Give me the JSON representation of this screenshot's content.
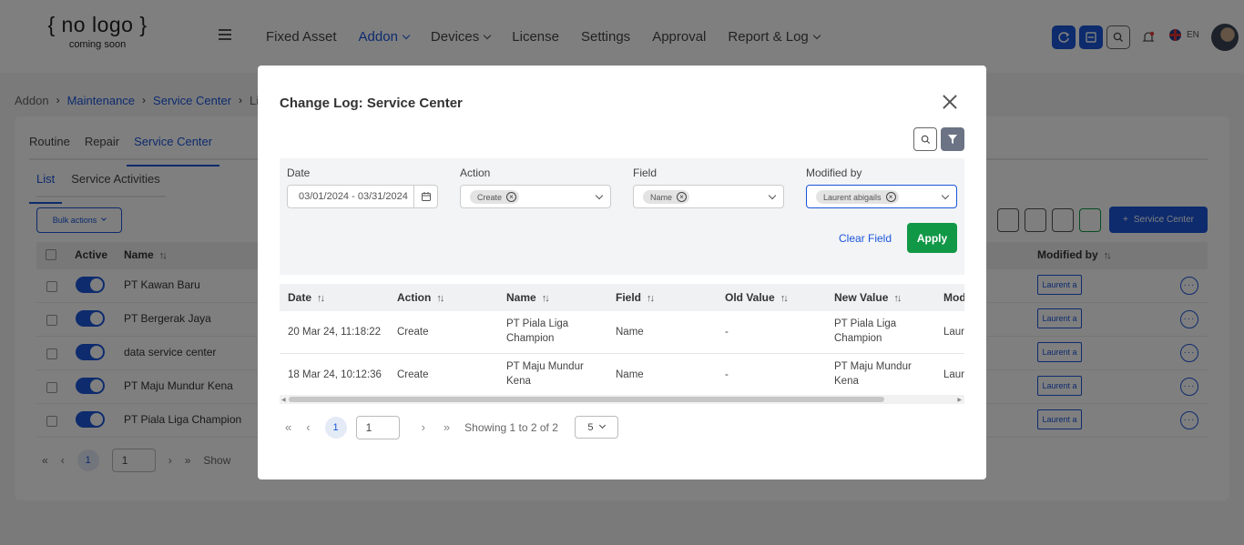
{
  "header": {
    "logo_main": "{ no logo }",
    "logo_sub": "coming soon",
    "nav": [
      {
        "label": "Fixed Asset"
      },
      {
        "label": "Addon"
      },
      {
        "label": "Devices"
      },
      {
        "label": "License"
      },
      {
        "label": "Settings"
      },
      {
        "label": "Approval"
      },
      {
        "label": "Report & Log"
      }
    ],
    "language": "EN",
    "accent_color": "#1a56db"
  },
  "breadcrumb": [
    "Addon",
    "Maintenance",
    "Service Center",
    "List"
  ],
  "page": {
    "tabs": [
      "Routine",
      "Repair",
      "Service Center"
    ],
    "subtabs": [
      "List",
      "Service Activities"
    ],
    "bulk_actions": "Bulk actions",
    "add_button": "Service Center",
    "columns": {
      "active": "Active",
      "name": "Name",
      "modified_by": "Modified by"
    },
    "rows": [
      {
        "name": "PT Kawan Baru",
        "modified_by": "Laurent a"
      },
      {
        "name": "PT Bergerak Jaya",
        "modified_by": "Laurent a"
      },
      {
        "name": "data service center",
        "modified_by": "Laurent a"
      },
      {
        "name": "PT Maju Mundur Kena",
        "modified_by": "Laurent a"
      },
      {
        "name": "PT Piala Liga Champion",
        "modified_by": "Laurent a"
      }
    ],
    "pagination": {
      "current_page": "1",
      "page_input": "1",
      "showing": "Show"
    }
  },
  "modal": {
    "title": "Change Log: Service Center",
    "filters": {
      "date_label": "Date",
      "date_value": "03/01/2024 - 03/31/2024",
      "action_label": "Action",
      "action_chip": "Create",
      "field_label": "Field",
      "field_chip": "Name",
      "modified_label": "Modified by",
      "modified_chip": "Laurent abigails",
      "clear": "Clear Field",
      "apply": "Apply"
    },
    "columns": [
      "Date",
      "Action",
      "Name",
      "Field",
      "Old Value",
      "New Value",
      "Mod"
    ],
    "rows": [
      {
        "date": "20 Mar 24, 11:18:22",
        "action": "Create",
        "name": "PT Piala Liga Champion",
        "field": "Name",
        "old": "-",
        "new": "PT Piala Liga Champion",
        "mod": "Laur"
      },
      {
        "date": "18 Mar 24, 10:12:36",
        "action": "Create",
        "name": "PT Maju Mundur Kena",
        "field": "Name",
        "old": "-",
        "new": "PT Maju Mundur Kena",
        "mod": "Laur"
      }
    ],
    "pagination": {
      "current_page": "1",
      "page_input": "1",
      "showing": "Showing 1 to 2 of 2",
      "page_size": "5"
    },
    "apply_color": "#119847"
  }
}
